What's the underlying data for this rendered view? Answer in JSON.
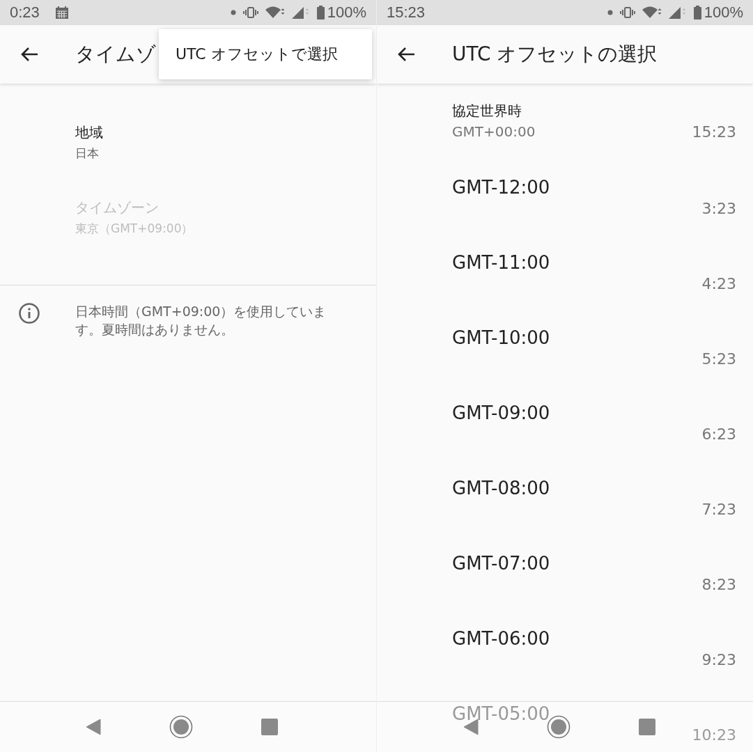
{
  "settings_screen": {
    "status_bar": {
      "time": "0:23",
      "battery": "100%"
    },
    "app_bar": {
      "title": "タイムゾ"
    },
    "overflow_menu": {
      "items": [
        {
          "label": "UTC オフセットで選択"
        }
      ]
    },
    "preferences": [
      {
        "title": "地域",
        "summary": "日本",
        "disabled": false
      },
      {
        "title": "タイムゾーン",
        "summary": "東京（GMT+09:00）",
        "disabled": true
      }
    ],
    "footer": "日本時間（GMT+09:00）を使用しています。夏時間はありません。"
  },
  "offset_screen": {
    "status_bar": {
      "time": "15:23",
      "battery": "100%"
    },
    "app_bar": {
      "title": "UTC オフセットの選択"
    },
    "offsets": [
      {
        "name": "協定世界時",
        "offset": "GMT+00:00",
        "time": "15:23"
      },
      {
        "name": "GMT-12:00",
        "time": "3:23"
      },
      {
        "name": "GMT-11:00",
        "time": "4:23"
      },
      {
        "name": "GMT-10:00",
        "time": "5:23"
      },
      {
        "name": "GMT-09:00",
        "time": "6:23"
      },
      {
        "name": "GMT-08:00",
        "time": "7:23"
      },
      {
        "name": "GMT-07:00",
        "time": "8:23"
      },
      {
        "name": "GMT-06:00",
        "time": "9:23"
      },
      {
        "name": "GMT-05:00",
        "time": "10:23"
      }
    ]
  }
}
